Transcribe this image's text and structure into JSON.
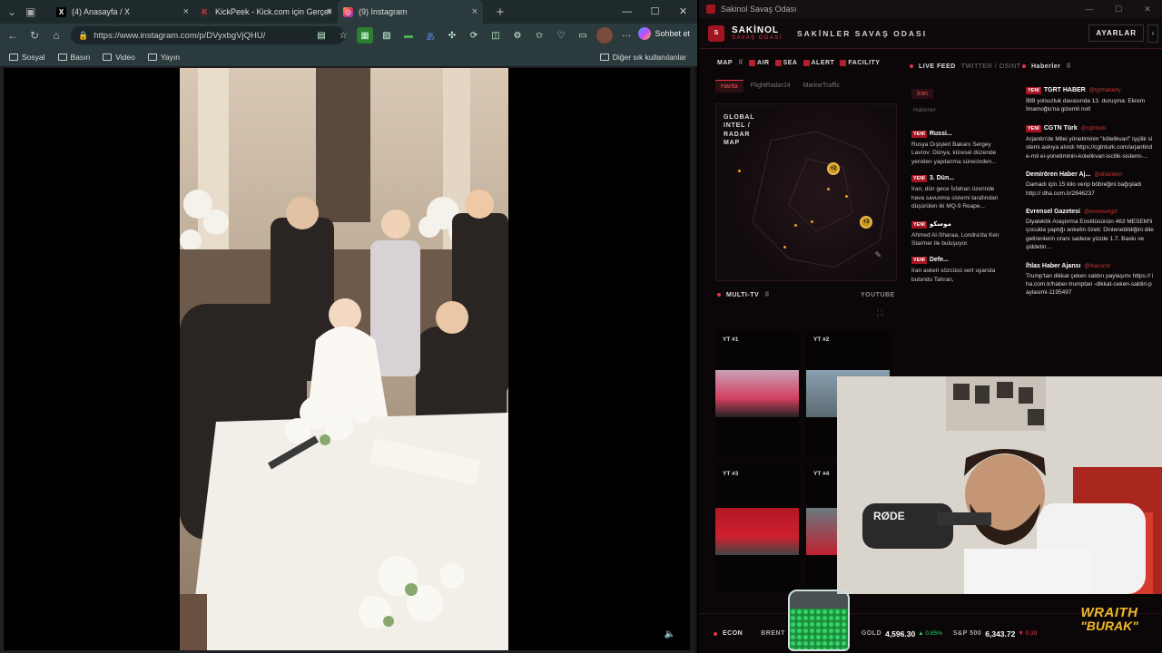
{
  "browser": {
    "tabs": [
      {
        "label": "(4) Anasayfa / X",
        "icon": "x-logo-icon",
        "active": false
      },
      {
        "label": "KickPeek - Kick.com için Gerçek Za",
        "icon": "kickpeek-icon",
        "active": false
      },
      {
        "label": "(9) Instagram",
        "icon": "instagram-icon",
        "active": true
      }
    ],
    "url": "https://www.instagram.com/p/DVyxbgVjQHU/",
    "copilot_label": "Sohbet et",
    "bookmarks": [
      "Sosyal",
      "Basın",
      "Video",
      "Yayın"
    ],
    "other_bookmarks": "Diğer sık kullanılanlar"
  },
  "dashboard": {
    "window_title": "Sakinol Savaş Odası",
    "brand": "SAKİNOL",
    "brand_sub": "SAVAŞ ODASI",
    "header_title": "SAKİNLER SAVAŞ ODASI",
    "settings_label": "AYARLAR",
    "map_panel": {
      "title": "MAP",
      "filters": [
        "AIR",
        "SEA",
        "ALERT",
        "FACILITY"
      ],
      "tabs": [
        "Harita",
        "FlightRadar24",
        "MarineTraffic"
      ],
      "map_title": "GLOBAL INTEL / RADAR MAP",
      "markers": [
        "+2",
        "+3"
      ]
    },
    "live_feed": {
      "title": "LIVE FEED",
      "sub": "TWITTER / OSINT",
      "tab": "İran",
      "filter": "Haberler",
      "items": [
        {
          "tag": "YENİ",
          "title": "Russi...",
          "text": "Rusya Dışişleri Bakanı Sergey Lavrov: Dünya, küresel düzende yeniden yapılanma sürecinden..."
        },
        {
          "tag": "YENİ",
          "title": "3. Dün...",
          "text": "İran, dün gece İsfahan üzerinde hava savunma sistemi tarafından düşürülen iki MQ-9 Reape..."
        },
        {
          "tag": "YENİ",
          "title": "موسكو",
          "text": "Ahmed Al-Sharaa, Londra'da Keir Starmer ile buluşuyor."
        },
        {
          "tag": "YENİ",
          "title": "Defe...",
          "text": "İran askeri sözcüsü sert uyarıda bulundu Tahran,"
        }
      ]
    },
    "news": {
      "title": "Haberler",
      "items": [
        {
          "tag": "YENİ",
          "source": "TGRT HABER",
          "handle": "@tgrthaberty",
          "text": "İBB yolsuzluk davasında 13. duruşma: Ekrem İmamoğlu'na gizemli not!"
        },
        {
          "tag": "YENİ",
          "source": "CGTN Türk",
          "handle": "@cgtnturk",
          "text": "Arjantin'de Milei yönetiminin \"kölelikvari\" işçilik sistemi askıya alındı https://cgtnturk.com/arjantinde-mil ei-yonetiminin-kolelikvari-iscilik-sistemi-..."
        },
        {
          "tag": "",
          "source": "Demirören Haber Aj...",
          "handle": "@dhaintern",
          "text": "Damadı için 15 kilo verip böbreğini bağışladı http:// dha.com.tr/2846237"
        },
        {
          "tag": "",
          "source": "Evrensel Gazetesi",
          "handle": "@evrenselgzt",
          "text": "Diyalektik Araştırma Enstitüsünün 463 MESEM'li çocukla yaptığı anketin özeti: Dinlenebildiğini dile getirenlerin oranı sadece yüzde 1.7. Baskı ve şiddetin..."
        },
        {
          "tag": "",
          "source": "İhlas Haber Ajansı",
          "handle": "@ihacomtr",
          "text": "Trump'tan dikkat çeken saldırı paylaşımı https:// iha.com.tr/haber-trumptan -dikkat-ceken-saldiri-paylasimi-1195497"
        }
      ]
    },
    "multi_tv": {
      "title": "MULTI-TV",
      "source": "YOUTUBE",
      "cells": [
        "YT #1",
        "YT #2",
        "YT #3",
        "YT #4"
      ]
    },
    "ticker": [
      {
        "label": "ECON",
        "value": "",
        "change": ""
      },
      {
        "label": "BRENT",
        "value": "",
        "change": ""
      },
      {
        "label": "GOLD",
        "value": "4,596.30",
        "change": "▲ 0.85%"
      },
      {
        "label": "S&P 500",
        "value": "6,343.72",
        "change": "▼ 0.39"
      }
    ],
    "overlay_brand_1": "WRAITH",
    "overlay_brand_2": "\"BURAK\""
  },
  "colors": {
    "accent": "#e23646",
    "brand_red": "#a31421",
    "gold": "#f0b92a"
  }
}
